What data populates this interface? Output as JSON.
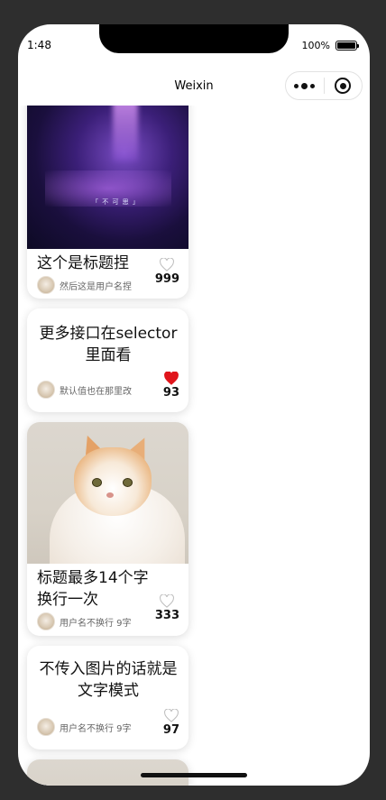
{
  "status": {
    "time": "1:48",
    "battery": "100%"
  },
  "nav": {
    "title": "Weixin"
  },
  "cards": [
    {
      "type": "image",
      "image_caption": "「 不 可 思 」",
      "title": "这个是标题捏",
      "username": "然后这是用户名捏",
      "likes": "999",
      "liked": false
    },
    {
      "type": "text",
      "title": "更多接口在selector里面看",
      "username": "默认值也在那里改",
      "likes": "93",
      "liked": true
    },
    {
      "type": "image",
      "title": "标题最多14个字换行一次",
      "username": "用户名不换行 9字",
      "likes": "333",
      "liked": false
    },
    {
      "type": "text",
      "title": "不传入图片的话就是文字模式",
      "username": "用户名不换行 9字",
      "likes": "97",
      "liked": false
    }
  ],
  "colors": {
    "heart_liked": "#e0151b",
    "heart_outline": "#bbbbbb"
  }
}
